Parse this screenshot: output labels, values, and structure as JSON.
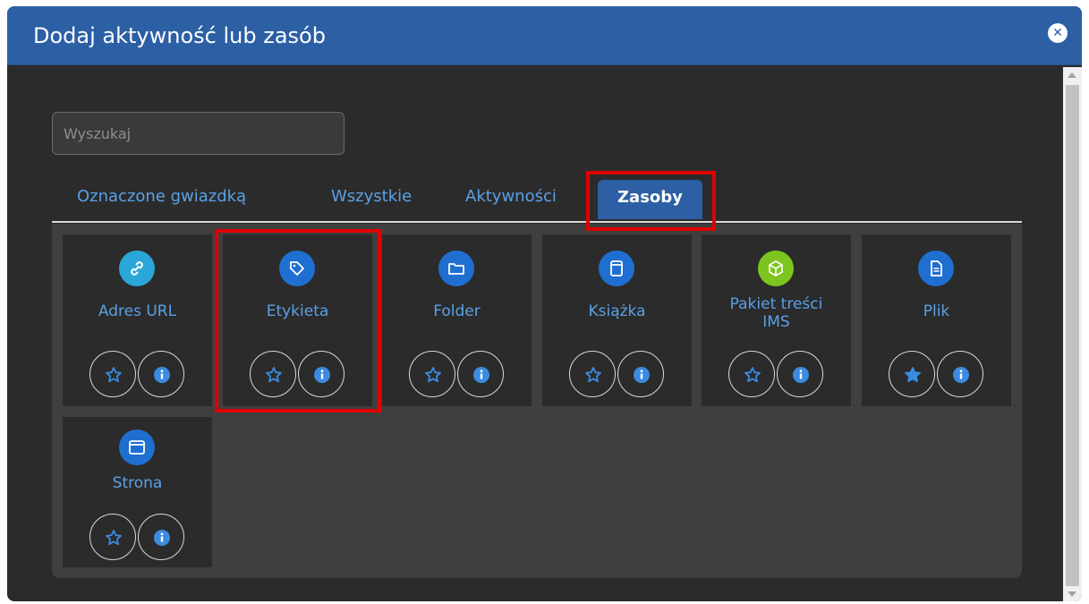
{
  "modal": {
    "title": "Dodaj aktywność lub zasób",
    "close_icon": "close-circle-icon"
  },
  "search": {
    "placeholder": "Wyszukaj",
    "value": ""
  },
  "tabs": [
    {
      "label": "Oznaczone gwiazdką",
      "active": false
    },
    {
      "label": "Wszystkie",
      "active": false
    },
    {
      "label": "Aktywności",
      "active": false
    },
    {
      "label": "Zasoby",
      "active": true
    }
  ],
  "items": [
    {
      "name": "Adres URL",
      "icon": "link-icon",
      "icon_color": "#2aa7d8",
      "starred": false
    },
    {
      "name": "Etykieta",
      "icon": "tag-icon",
      "icon_color": "#1f6fd1",
      "starred": false
    },
    {
      "name": "Folder",
      "icon": "folder-icon",
      "icon_color": "#1f6fd1",
      "starred": false
    },
    {
      "name": "Książka",
      "icon": "book-icon",
      "icon_color": "#1f6fd1",
      "starred": false
    },
    {
      "name": "Pakiet treści IMS",
      "icon": "package-icon",
      "icon_color": "#7ec41e",
      "starred": false
    },
    {
      "name": "Plik",
      "icon": "file-icon",
      "icon_color": "#1f6fd1",
      "starred": true
    },
    {
      "name": "Strona",
      "icon": "page-icon",
      "icon_color": "#1f6fd1",
      "starred": false
    }
  ],
  "colors": {
    "header": "#2c5fa4",
    "link_text": "#5aa0e6",
    "highlight": "#e00000"
  }
}
